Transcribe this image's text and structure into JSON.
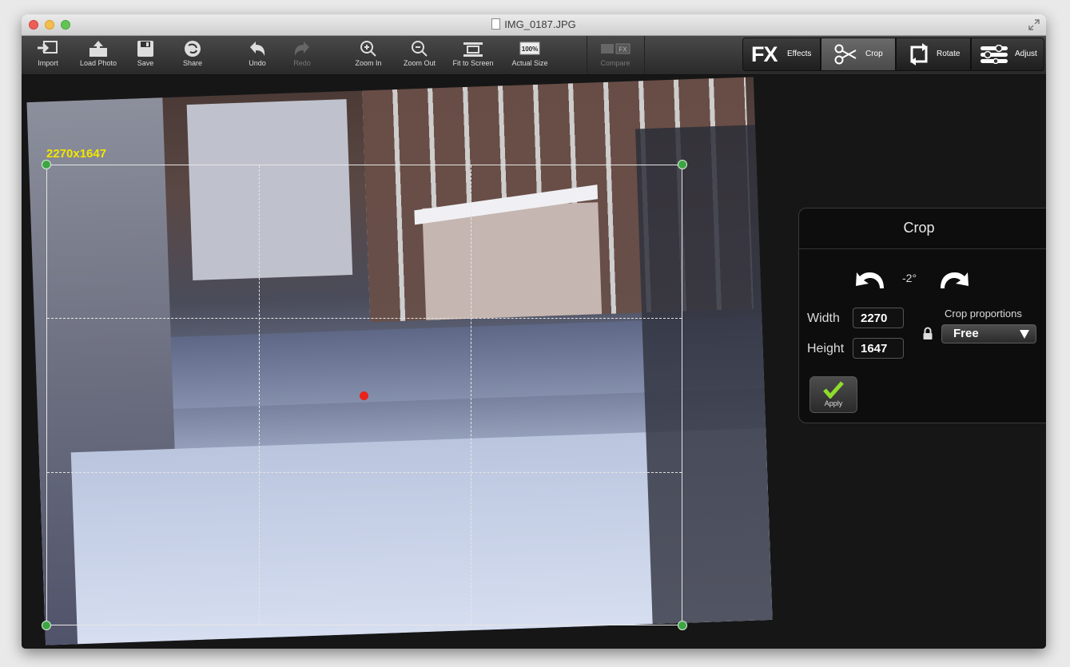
{
  "window": {
    "title": "IMG_0187.JPG"
  },
  "toolbar": {
    "buttons": [
      {
        "label": "Import",
        "icon": "import-icon"
      },
      {
        "label": "Load Photo",
        "icon": "load-photo-icon"
      },
      {
        "label": "Save",
        "icon": "save-icon"
      },
      {
        "label": "Share",
        "icon": "share-icon"
      },
      {
        "label": "Undo",
        "icon": "undo-icon"
      },
      {
        "label": "Redo",
        "icon": "redo-icon",
        "disabled": true
      },
      {
        "label": "Zoom In",
        "icon": "zoom-in-icon"
      },
      {
        "label": "Zoom Out",
        "icon": "zoom-out-icon"
      },
      {
        "label": "Fit to Screen",
        "icon": "fit-to-screen-icon"
      },
      {
        "label": "Actual Size",
        "icon": "actual-size-icon",
        "icon_text": "100%"
      },
      {
        "label": "Compare",
        "icon": "compare-icon",
        "disabled": true,
        "icon_text": "FX"
      }
    ],
    "modes": [
      {
        "label": "Effects",
        "icon_text": "FX",
        "icon": "fx-icon",
        "active": false
      },
      {
        "label": "Crop",
        "icon": "scissors-icon",
        "active": true
      },
      {
        "label": "Rotate",
        "icon": "rotate-icon",
        "active": false
      },
      {
        "label": "Adjust",
        "icon": "sliders-icon",
        "active": false
      }
    ]
  },
  "canvas": {
    "crop_dimensions_label": "2270x1647",
    "crop_handle_color": "#3ea544",
    "center_marker_color": "#e8231d",
    "dimension_label_color": "#f2e600"
  },
  "crop_panel": {
    "title": "Crop",
    "rotation_label": "-2°",
    "width_label": "Width",
    "width_value": "2270",
    "height_label": "Height",
    "height_value": "1647",
    "proportions_label": "Crop proportions",
    "proportions_value": "Free",
    "apply_label": "Apply"
  }
}
